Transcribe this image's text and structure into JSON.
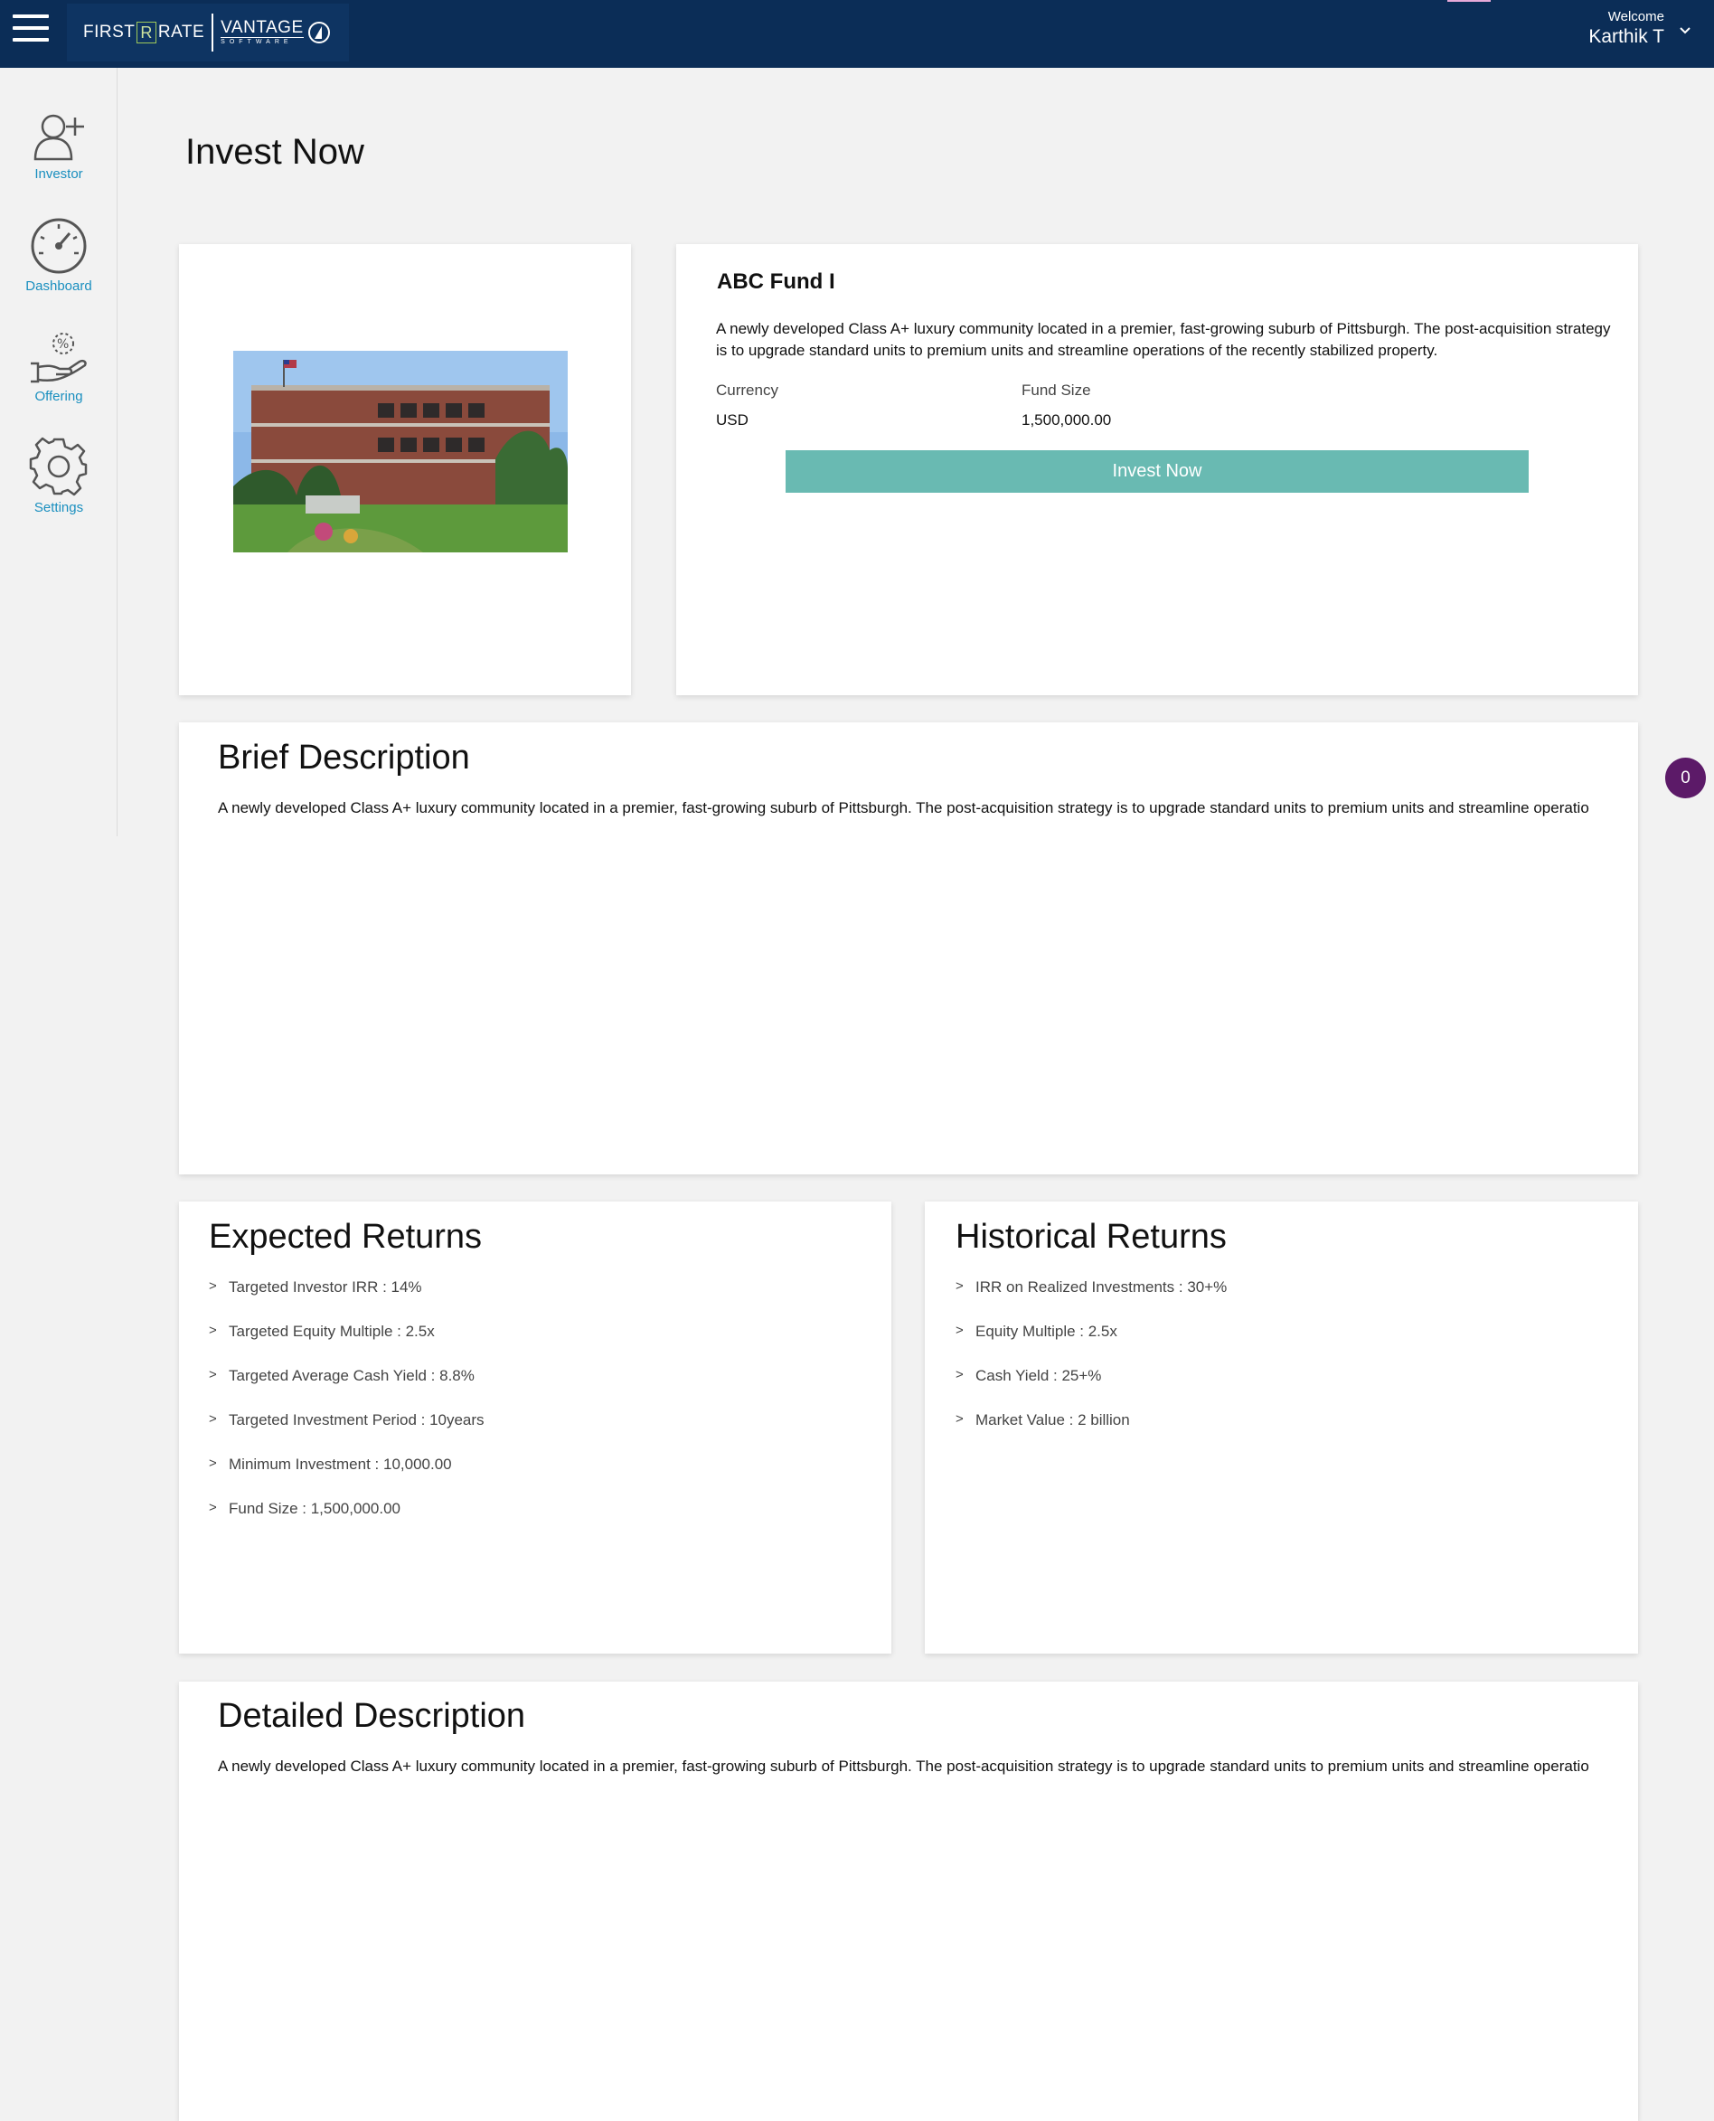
{
  "header": {
    "logo": {
      "first": "FIRST",
      "r": "R",
      "rate": "RATE",
      "vantage": "VANTAGE",
      "software": "SOFTWARE"
    },
    "welcome_label": "Welcome",
    "user_name": "Karthik T"
  },
  "sidebar": {
    "items": [
      {
        "label": "Investor",
        "icon": "add-user-icon"
      },
      {
        "label": "Dashboard",
        "icon": "gauge-icon"
      },
      {
        "label": "Offering",
        "icon": "offering-hand-icon"
      },
      {
        "label": "Settings",
        "icon": "gear-icon"
      }
    ]
  },
  "page": {
    "title": "Invest Now"
  },
  "fund": {
    "name": "ABC Fund I",
    "description": "A newly developed Class A+ luxury community located in a premier, fast-growing suburb of Pittsburgh. The post-acquisition strategy is to upgrade standard units to premium units and streamline operations of the recently stabilized property.",
    "currency_label": "Currency",
    "currency_value": "USD",
    "fund_size_label": "Fund Size",
    "fund_size_value": "1,500,000.00",
    "invest_button": "Invest Now"
  },
  "brief": {
    "title": "Brief Description",
    "text": "A newly developed Class A+ luxury community located in a premier, fast-growing suburb of Pittsburgh. The post-acquisition strategy is to upgrade standard units to premium units and streamline operatio"
  },
  "expected": {
    "title": "Expected Returns",
    "items": [
      "Targeted Investor IRR : 14%",
      "Targeted Equity Multiple : 2.5x",
      "Targeted Average Cash Yield : 8.8%",
      "Targeted Investment Period : 10years",
      "Minimum Investment : 10,000.00",
      "Fund Size : 1,500,000.00"
    ]
  },
  "historical": {
    "title": "Historical Returns",
    "items": [
      "IRR on Realized Investments : 30+%",
      "Equity Multiple : 2.5x",
      "Cash Yield : 25+%",
      "Market Value : 2 billion"
    ]
  },
  "detailed": {
    "title": "Detailed Description",
    "text": "A newly developed Class A+ luxury community located in a premier, fast-growing suburb of Pittsburgh. The post-acquisition strategy is to upgrade standard units to premium units and streamline operatio"
  },
  "list_marker": ">",
  "badge_count": "0",
  "colors": {
    "header": "#0b2d57",
    "accent_teal": "#69bab2",
    "nav_text": "#1a8fbf",
    "badge": "#5c1a68"
  }
}
